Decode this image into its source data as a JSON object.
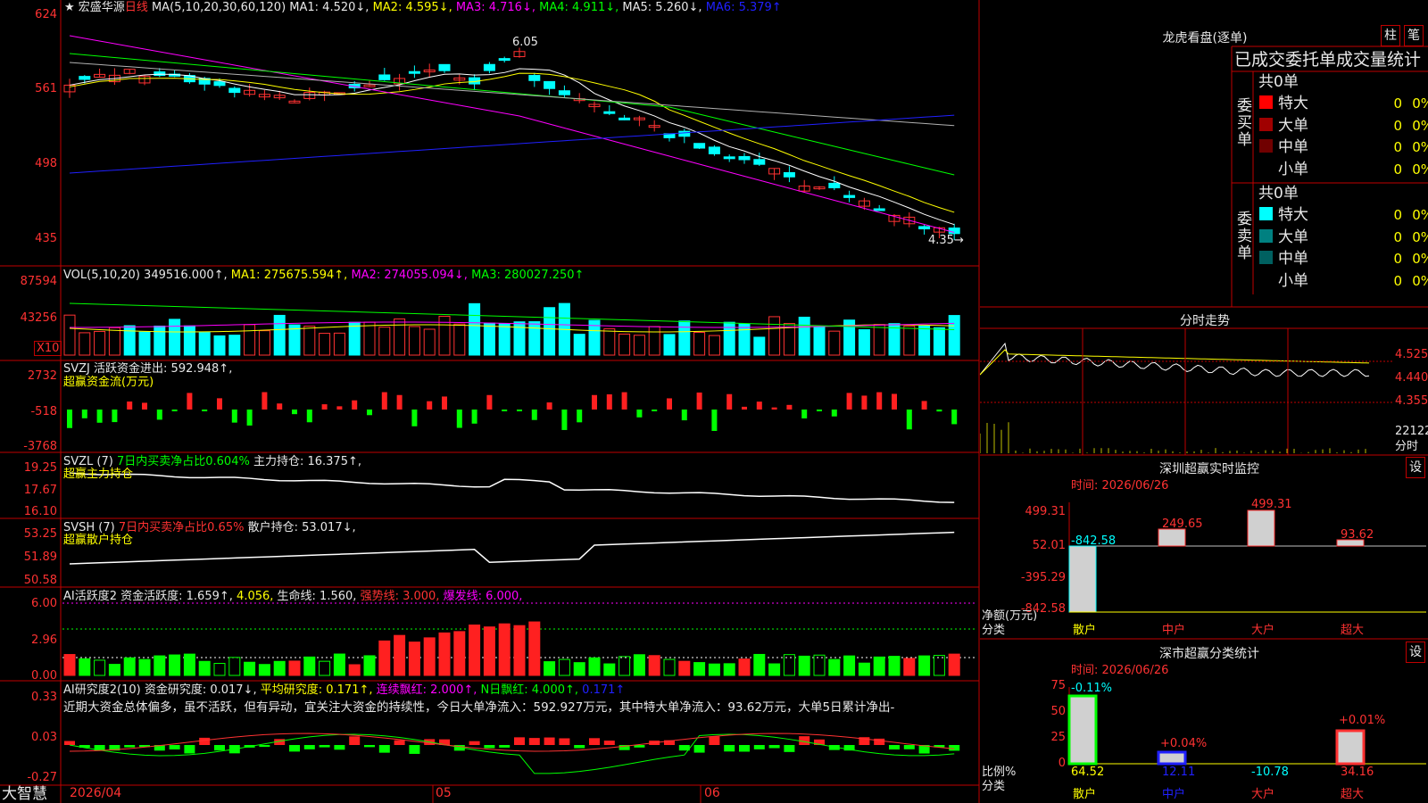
{
  "stock": {
    "star": "★",
    "name": "宏盛华源",
    "period": "日线"
  },
  "main_panel": {
    "ma_label": "MA(5,10,20,30,60,120)",
    "ma1": "MA1: 4.520↓,",
    "ma2": "MA2: 4.595↓,",
    "ma3": "MA3: 4.716↓,",
    "ma4": "MA4: 4.911↓,",
    "ma5": "MA5: 5.260↓,",
    "ma6": "MA6: 5.379↑",
    "y_labels": [
      "624",
      "561",
      "498",
      "435"
    ],
    "high_note": "6.05",
    "low_note": "4.35→"
  },
  "vol_panel": {
    "label": "VOL(5,10,20)",
    "vol": "349516.000↑,",
    "ma1": "MA1: 275675.594↑,",
    "ma2": "MA2: 274055.094↓,",
    "ma3": "MA3: 280027.250↑",
    "y_labels": [
      "87594",
      "43256"
    ],
    "unit": "X10"
  },
  "svzj_panel": {
    "label": "SVZJ",
    "active": "活跃资金进出: 592.948↑,",
    "subtitle": "超赢资金流(万元)",
    "y_labels": [
      "2732",
      "-518",
      "-3768"
    ]
  },
  "svzl_panel": {
    "label": "SVZL (7)",
    "ratio": "7日内买卖净占比0.604%",
    "hold": "主力持仓: 16.375↑,",
    "subtitle": "超赢主力持仓",
    "y_labels": [
      "19.25",
      "17.67",
      "16.10"
    ]
  },
  "svsh_panel": {
    "label": "SVSH (7)",
    "ratio": "7日内买卖净占比0.65%",
    "hold": "散户持仓: 53.017↓,",
    "subtitle": "超赢散户持仓",
    "y_labels": [
      "53.25",
      "51.89",
      "50.58"
    ]
  },
  "ai_active_panel": {
    "label": "AI活跃度2",
    "active": "资金活跃度: 1.659↑,",
    "v2": "4.056,",
    "life": "生命线: 1.560,",
    "strong": "强势线: 3.000,",
    "burst": "爆发线: 6.000,",
    "y_labels": [
      "6.00",
      "2.96",
      "0.00"
    ]
  },
  "ai_research_panel": {
    "label": "AI研究度2(10)",
    "research": "资金研究度: 0.017↓,",
    "avg": "平均研究度: 0.171↑,",
    "cont": "连续飘红: 2.000↑,",
    "nday": "N日飘红: 4.000↑,",
    "v5": "0.171↑",
    "comment": "近期大资金总体偏多，虽不活跃，但有异动，宜关注大资金的持续性，今日大单净流入：592.927万元，其中特大单净流入：93.62万元，大单5日累计净出-",
    "y_labels": [
      "0.33",
      "0.03",
      "-0.27"
    ]
  },
  "bottom_axis": {
    "brand": "大智慧",
    "date": "2026/04",
    "m5": "05",
    "m6": "06"
  },
  "lhb": {
    "title": "龙虎看盘(逐单)",
    "btn1": "柱",
    "btn2": "笔",
    "header": "已成交委托单成交量统计",
    "buy_side": "委买单",
    "buy_total": "共0单",
    "sell_side": "委卖单",
    "sell_total": "共0单",
    "rows_buy": [
      {
        "label": "特大",
        "value": "0",
        "pct": "0%",
        "color": "#ff0000"
      },
      {
        "label": "大单",
        "value": "0",
        "pct": "0%",
        "color": "#a00000"
      },
      {
        "label": "中单",
        "value": "0",
        "pct": "0%",
        "color": "#700000"
      },
      {
        "label": "小单",
        "value": "0",
        "pct": "0%",
        "color": "#000000"
      }
    ],
    "rows_sell": [
      {
        "label": "特大",
        "value": "0",
        "pct": "0%",
        "color": "#00ffff"
      },
      {
        "label": "大单",
        "value": "0",
        "pct": "0%",
        "color": "#008080"
      },
      {
        "label": "中单",
        "value": "0",
        "pct": "0%",
        "color": "#006060"
      },
      {
        "label": "小单",
        "value": "0",
        "pct": "0%",
        "color": "#000000"
      }
    ]
  },
  "intraday": {
    "title": "分时走势",
    "p1": "4.525",
    "p2": "4.440",
    "p3": "4.355",
    "vol": "22122",
    "vol_unit": "分时"
  },
  "sz_monitor": {
    "title": "深圳超赢实时监控",
    "btn": "设",
    "time": "时间: 2026/06/26",
    "y_labels": [
      "499.31",
      "52.01",
      "-395.29",
      "-842.58"
    ],
    "bar_labels": [
      "-842.58",
      "249.65",
      "499.31",
      "93.62"
    ],
    "ylab1": "净额(万元)",
    "ylab2": "分类",
    "categories": [
      "散户",
      "中户",
      "大户",
      "超大"
    ]
  },
  "sz_class": {
    "title": "深市超赢分类统计",
    "btn": "设",
    "time": "时间: 2026/06/26",
    "y_labels": [
      "75",
      "50",
      "25",
      "0"
    ],
    "top_labels": [
      "-0.11%",
      "+0.04%",
      "+0.01%"
    ],
    "bottom_values": [
      "64.52",
      "12.11",
      "-10.78",
      "34.16"
    ],
    "ylab1": "比例%",
    "ylab2": "分类",
    "categories": [
      "散户",
      "中户",
      "大户",
      "超大"
    ]
  }
}
